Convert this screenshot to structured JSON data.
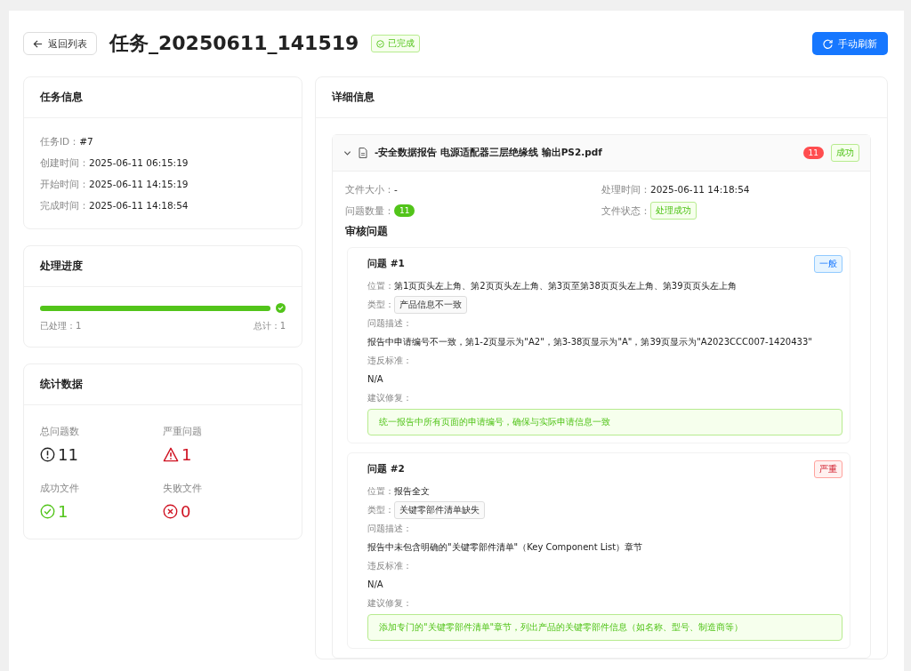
{
  "header": {
    "back_button": "返回列表",
    "title": "任务_20250611_141519",
    "status": "已完成",
    "refresh_button": "手动刷新"
  },
  "task_info": {
    "title": "任务信息",
    "fields": [
      {
        "label": "任务ID：",
        "value": "#7"
      },
      {
        "label": "创建时间：",
        "value": "2025-06-11 06:15:19"
      },
      {
        "label": "开始时间：",
        "value": "2025-06-11 14:15:19"
      },
      {
        "label": "完成时间：",
        "value": "2025-06-11 14:18:54"
      }
    ]
  },
  "progress": {
    "title": "处理进度",
    "level": 1,
    "processed": "已处理：1",
    "total": "总计：1"
  },
  "stats": {
    "title": "统计数据",
    "items": [
      {
        "kind": "info",
        "label": "总问题数",
        "value": "11"
      },
      {
        "kind": "warning",
        "label": "严重问题",
        "value": "1"
      },
      {
        "kind": "success",
        "label": "成功文件",
        "value": "1"
      },
      {
        "kind": "error",
        "label": "失败文件",
        "value": "0"
      }
    ]
  },
  "details": {
    "title": "详细信息",
    "file": {
      "name": "-安全数据报告 电源适配器三层绝缘线 输出PS2.pdf",
      "expanded": true,
      "count_badge": "11",
      "status_tag": "成功",
      "size_label": "文件大小：",
      "size": "-",
      "time_label": "处理时间：",
      "time": "2025-06-11 14:18:54",
      "count_label": "问题数量：",
      "count": "11",
      "state_label": "文件状态：",
      "state": "处理成功"
    },
    "issues_title": "审核问题",
    "issues": [
      {
        "title": "问题 #1",
        "severity": "一般",
        "kind": "normal",
        "location_label": "位置：",
        "location": "第1页页头左上角、第2页页头左上角、第3页至第38页页头左上角、第39页页头左上角",
        "type_label": "类型：",
        "type": "产品信息不一致",
        "desc_label": "问题描述：",
        "desc": "报告中申请编号不一致，第1-2页显示为\"A2\"，第3-38页显示为\"A\"，第39页显示为\"A2023CCC007-1420433\"",
        "std_label": "违反标准：",
        "std": "N/A",
        "fix_label": "建议修复：",
        "fix": "统一报告中所有页面的申请编号，确保与实际申请信息一致"
      },
      {
        "title": "问题 #2",
        "severity": "严重",
        "kind": "severe",
        "location_label": "位置：",
        "location": "报告全文",
        "type_label": "类型：",
        "type": "关键零部件清单缺失",
        "desc_label": "问题描述：",
        "desc": "报告中未包含明确的\"关键零部件清单\"（Key Component List）章节",
        "std_label": "违反标准：",
        "std": "N/A",
        "fix_label": "建议修复：",
        "fix": "添加专门的\"关键零部件清单\"章节，列出产品的关键零部件信息（如名称、型号、制造商等）"
      }
    ]
  }
}
